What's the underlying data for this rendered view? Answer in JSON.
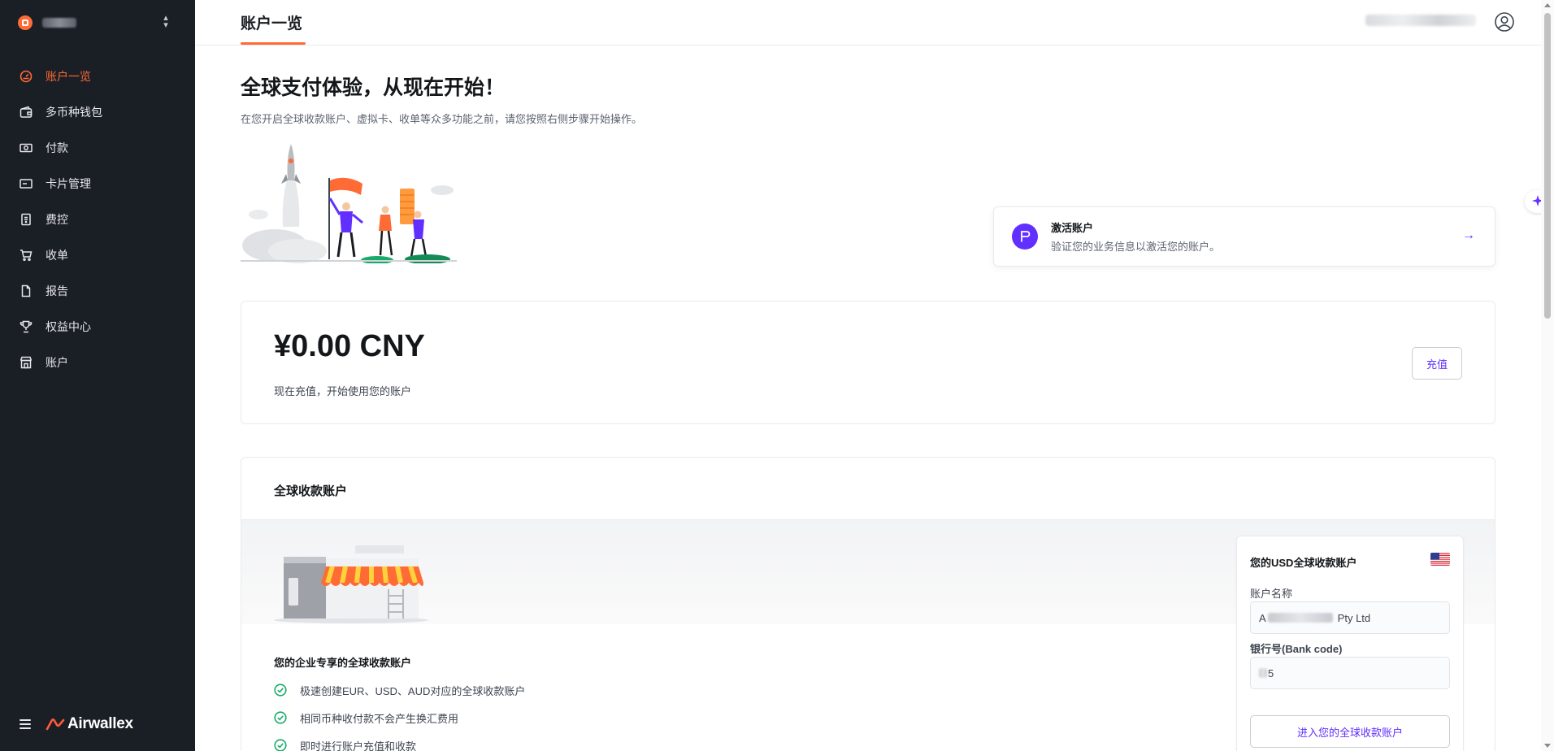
{
  "org": {
    "name": "",
    "logo_icon": "briefcase-icon"
  },
  "sidebar": {
    "items": [
      {
        "label": "账户一览",
        "icon": "dashboard-gauge-icon",
        "active": true
      },
      {
        "label": "多币种钱包",
        "icon": "wallet-icon",
        "active": false
      },
      {
        "label": "付款",
        "icon": "cash-icon",
        "active": false
      },
      {
        "label": "卡片管理",
        "icon": "card-icon",
        "active": false
      },
      {
        "label": "费控",
        "icon": "receipt-icon",
        "active": false
      },
      {
        "label": "收单",
        "icon": "cart-icon",
        "active": false
      },
      {
        "label": "报告",
        "icon": "document-icon",
        "active": false
      },
      {
        "label": "权益中心",
        "icon": "trophy-icon",
        "active": false
      },
      {
        "label": "账户",
        "icon": "store-icon",
        "active": false
      }
    ],
    "brand": "Airwallex"
  },
  "header": {
    "tab": "账户一览"
  },
  "hero": {
    "title": "全球支付体验，从现在开始！",
    "subtitle": "在您开启全球收款账户、虚拟卡、收单等众多功能之前，请您按照右侧步骤开始操作。"
  },
  "activate": {
    "title": "激活账户",
    "description": "验证您的业务信息以激活您的账户。"
  },
  "balance": {
    "amount": "¥0.00 CNY",
    "subtitle": "现在充值，开始使用您的账户",
    "topup_label": "充值"
  },
  "global_account": {
    "title": "全球收款账户",
    "heading": "您的企业专享的全球收款账户",
    "features": [
      "极速创建EUR、USD、AUD对应的全球收款账户",
      "相同币种收付款不会产生换汇费用",
      "即时进行账户充值和收款"
    ],
    "usd_panel": {
      "title": "您的USD全球收款账户",
      "account_name_label": "账户名称",
      "account_name_prefix": "A",
      "account_name_suffix": "Pty Ltd",
      "bank_code_label": "银行号(Bank code)",
      "bank_code_tail": "5",
      "enter_label": "进入您的全球收款账户"
    }
  },
  "colors": {
    "accent": "#ff6b35",
    "primary": "#612fff",
    "sidebar_bg": "#1a1e25",
    "success": "#1aab6a"
  }
}
